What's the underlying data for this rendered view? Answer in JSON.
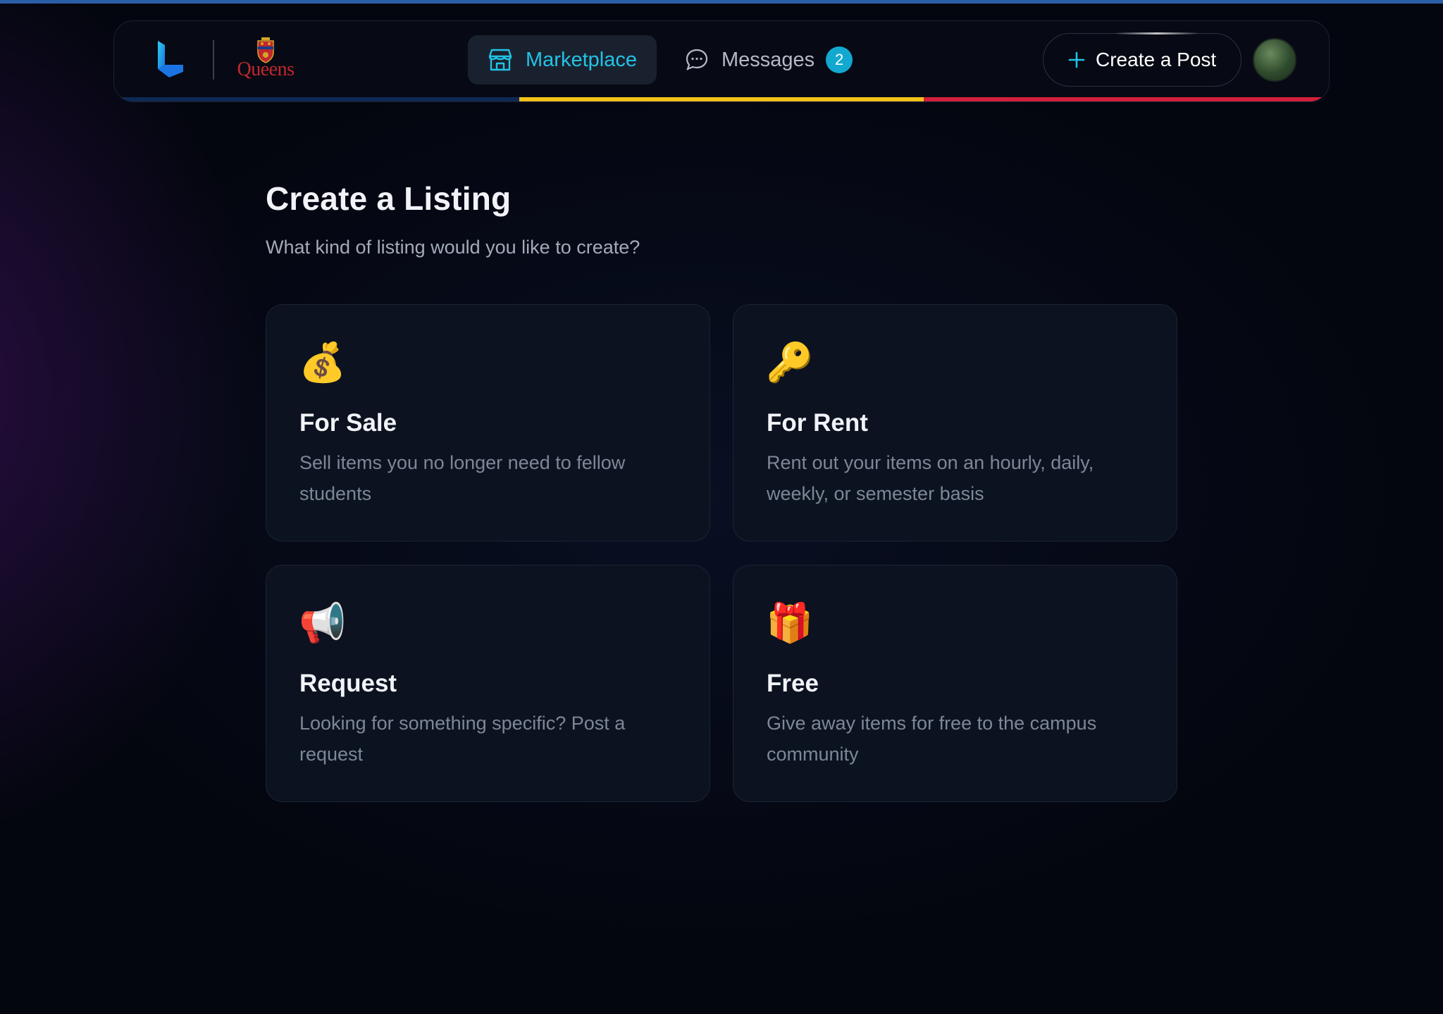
{
  "colors": {
    "accent": "#22c3e6",
    "badge": "#12a8cf",
    "stripe_blue": "#0e2a55",
    "stripe_gold": "#f2c21a",
    "stripe_red": "#d31f3b",
    "background": "#04060f"
  },
  "navbar": {
    "brand_icon": "app-logo-icon",
    "partner_logo_text": "Queens",
    "tabs": [
      {
        "label": "Marketplace",
        "icon": "storefront-icon",
        "active": true
      },
      {
        "label": "Messages",
        "icon": "chat-bubble-icon",
        "badge": "2",
        "active": false
      }
    ],
    "create_post": {
      "label": "Create a Post",
      "icon": "plus-icon"
    },
    "avatar": "user-avatar"
  },
  "main": {
    "title": "Create a Listing",
    "subtitle": "What kind of listing would you like to create?",
    "options": [
      {
        "icon": "💰",
        "icon_name": "money-bag-icon",
        "title": "For Sale",
        "description": "Sell items you no longer need to fellow students"
      },
      {
        "icon": "🔑",
        "icon_name": "key-icon",
        "title": "For Rent",
        "description": "Rent out your items on an hourly, daily, weekly, or semester basis"
      },
      {
        "icon": "📢",
        "icon_name": "megaphone-icon",
        "title": "Request",
        "description": "Looking for something specific? Post a request"
      },
      {
        "icon": "🎁",
        "icon_name": "gift-icon",
        "title": "Free",
        "description": "Give away items for free to the campus community"
      }
    ]
  }
}
